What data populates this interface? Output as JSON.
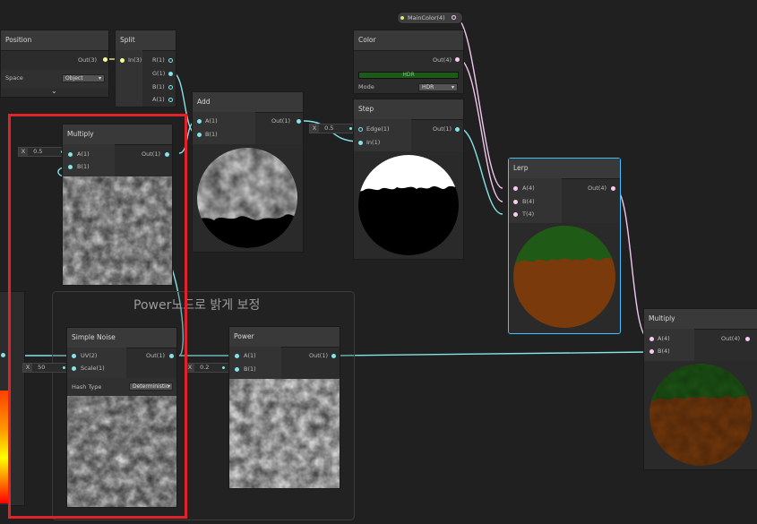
{
  "colors": {
    "background": "#202020",
    "port_float": "#84e4e7",
    "port_vec4": "#fbcbf4",
    "port_vec3": "#f6ff9a",
    "highlight": "#e0232a",
    "selected": "#44c0ff"
  },
  "property_node": {
    "label": "MainColor(4)"
  },
  "group": {
    "title": "Power노드로 밝게 보정"
  },
  "position_node": {
    "title": "Position",
    "out": "Out(3)",
    "space_label": "Space",
    "space_value": "Object",
    "collapse_icon": "chevron-down-icon"
  },
  "split_node": {
    "title": "Split",
    "in": "In(3)",
    "outs": [
      "R(1)",
      "G(1)",
      "B(1)",
      "A(1)"
    ]
  },
  "add_node": {
    "title": "Add",
    "ins": [
      "A(1)",
      "B(1)"
    ],
    "out": "Out(1)"
  },
  "color_node": {
    "title": "Color",
    "out": "Out(4)",
    "hdr_label": "HDR",
    "mode_label": "Mode",
    "mode_value": "HDR"
  },
  "step_node": {
    "title": "Step",
    "ins": [
      "Edge(1)",
      "In(1)"
    ],
    "out": "Out(1)",
    "edge_x": "X",
    "edge_value": "0.5"
  },
  "lerp_node": {
    "title": "Lerp",
    "ins": [
      "A(4)",
      "B(4)",
      "T(4)"
    ],
    "out": "Out(4)"
  },
  "multiply_top": {
    "title": "Multiply",
    "ins": [
      "A(1)",
      "B(1)"
    ],
    "out": "Out(1)",
    "a_x": "X",
    "a_value": "0.5"
  },
  "simple_noise": {
    "title": "Simple Noise",
    "ins": [
      "UV(2)",
      "Scale(1)"
    ],
    "out": "Out(1)",
    "scale_x": "X",
    "scale_value": "50",
    "hash_label": "Hash Type",
    "hash_value": "Deterministic"
  },
  "power_node": {
    "title": "Power",
    "ins": [
      "A(1)",
      "B(1)"
    ],
    "out": "Out(1)",
    "b_x": "X",
    "b_value": "0.2"
  },
  "multiply_right": {
    "title": "Multiply",
    "ins": [
      "A(4)",
      "B(4)"
    ],
    "out": "Out(4)"
  }
}
